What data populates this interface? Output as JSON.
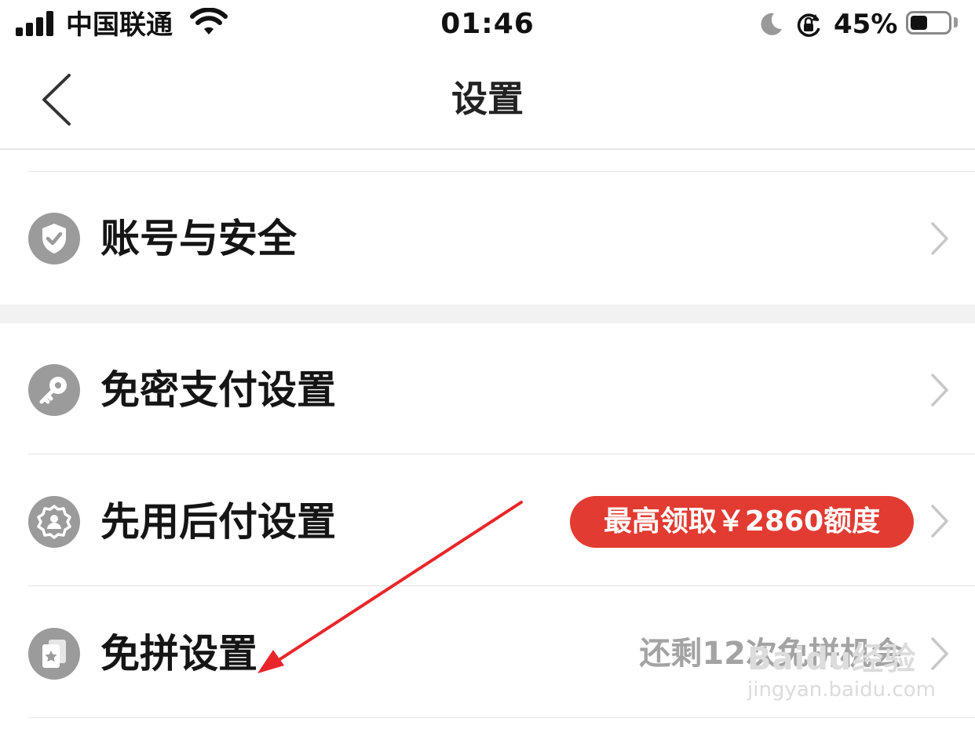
{
  "status_bar": {
    "carrier": "中国联通",
    "time": "01:46",
    "battery_percent": "45%",
    "battery_level": 0.45,
    "icons": [
      "signal-icon",
      "wifi-icon",
      "moon-icon",
      "rotation-lock-icon",
      "battery-icon"
    ]
  },
  "nav": {
    "title": "设置",
    "back_icon": "chevron-left-icon"
  },
  "settings": {
    "account_security": {
      "label": "账号与安全",
      "icon": "shield-check-icon"
    },
    "password_free_pay": {
      "label": "免密支付设置",
      "icon": "key-icon"
    },
    "pay_later": {
      "label": "先用后付设置",
      "icon": "badge-user-icon",
      "badge": "最高领取￥2860额度"
    },
    "group_free": {
      "label": "免拼设置",
      "icon": "star-card-icon",
      "hint": "还剩12次免拼机会"
    }
  },
  "annotation": {
    "arrow_color": "#e8262a"
  },
  "watermark": {
    "brand": "Baidu经验",
    "url": "jingyan.baidu.com"
  },
  "colors": {
    "badge": "#e23b32",
    "icon_gray": "#9b9b9b",
    "chevron": "#c8c8c8"
  }
}
